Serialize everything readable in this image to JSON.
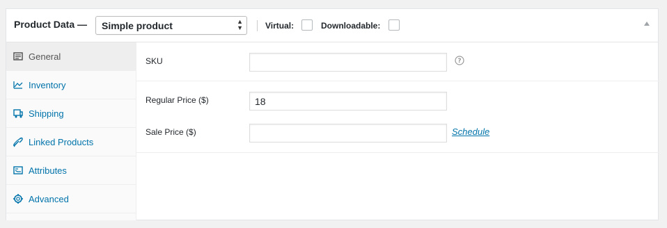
{
  "header": {
    "title": "Product Data —",
    "product_type": "Simple product",
    "virtual_label": "Virtual:",
    "downloadable_label": "Downloadable:"
  },
  "tabs": [
    {
      "label": "General",
      "icon": "general-icon",
      "active": true
    },
    {
      "label": "Inventory",
      "icon": "inventory-icon",
      "active": false
    },
    {
      "label": "Shipping",
      "icon": "shipping-icon",
      "active": false
    },
    {
      "label": "Linked Products",
      "icon": "link-icon",
      "active": false
    },
    {
      "label": "Attributes",
      "icon": "attributes-icon",
      "active": false
    },
    {
      "label": "Advanced",
      "icon": "gear-icon",
      "active": false
    }
  ],
  "fields": {
    "sku_label": "SKU",
    "sku_value": "",
    "regular_price_label": "Regular Price ($)",
    "regular_price_value": "18",
    "sale_price_label": "Sale Price ($)",
    "sale_price_value": "",
    "schedule_link": "Schedule"
  },
  "colors": {
    "link": "#0073aa",
    "active_tab_bg": "#eeeeee",
    "tab_bg": "#fafafa"
  }
}
